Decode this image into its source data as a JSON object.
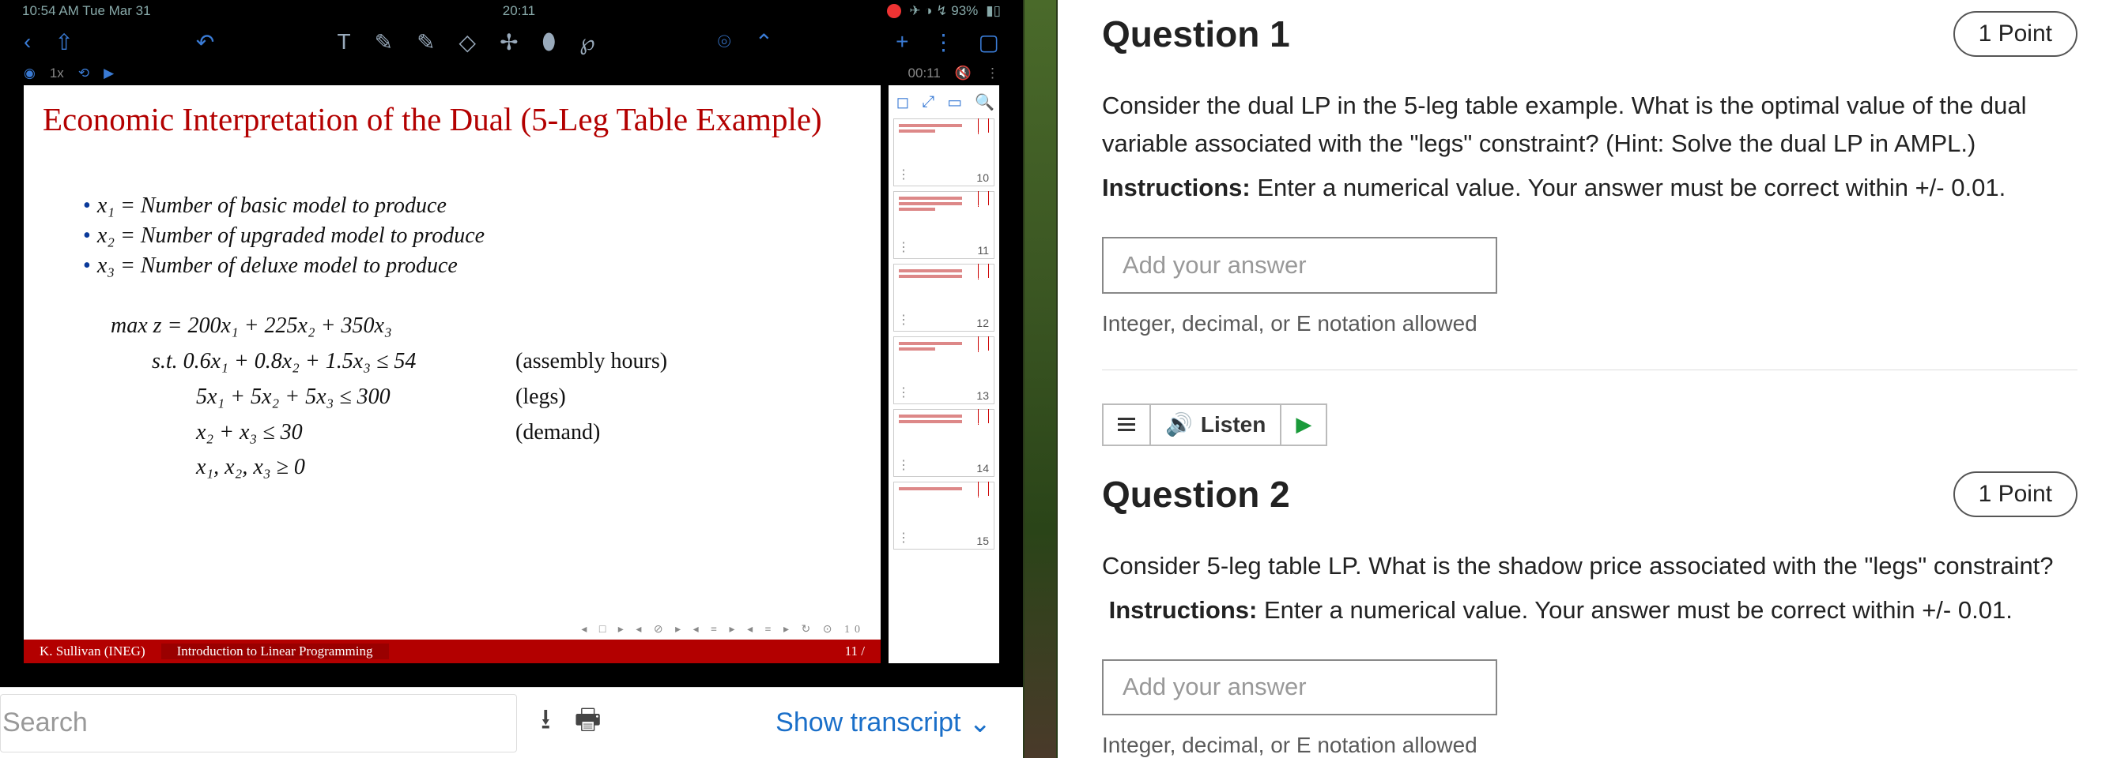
{
  "ipad": {
    "status_left": "10:54 AM   Tue Mar 31",
    "status_center": "20:11",
    "status_battery": "✈ ◑ ↯ 93%",
    "time_left_1x": "1x",
    "time_right_elapsed": "00:11",
    "slide": {
      "title": "Economic Interpretation of the Dual (5-Leg Table Example)",
      "bullets": [
        "x₁ = Number of basic model to produce",
        "x₂ = Number of upgraded model to produce",
        "x₃ = Number of deluxe model to produce"
      ],
      "obj": "max z = 200x₁ + 225x₂ + 350x₃",
      "c1_lhs": "s.t.  0.6x₁ + 0.8x₂ + 1.5x₃ ≤ 54",
      "c1_lab": "(assembly hours)",
      "c2_lhs": "5x₁ + 5x₂ + 5x₃ ≤ 300",
      "c2_lab": "(legs)",
      "c3_lhs": "x₂ + x₃ ≤ 30",
      "c3_lab": "(demand)",
      "c4_lhs": "x₁, x₂, x₃ ≥ 0",
      "footer_author": "K. Sullivan  (INEG)",
      "footer_title": "Introduction to Linear Programming",
      "footer_page": "11 /",
      "nav_icons": "◂ □ ▸  ◂ ⊘ ▸  ◂ ≡ ▸  ◂ ≡ ▸     ↻ ⊙ 10"
    },
    "thumbs": [
      "10",
      "11",
      "12",
      "13",
      "14",
      "15",
      "11"
    ]
  },
  "video_bar": {
    "search_placeholder": "Search",
    "show_transcript": "Show transcript"
  },
  "quiz": {
    "q1": {
      "title": "Question 1",
      "points": "1 Point",
      "text": "Consider the dual LP in the 5-leg table example.  What is the optimal value of the dual variable associated with the \"legs\" constraint?  (Hint: Solve the dual LP in AMPL.)",
      "instr_label": "Instructions:",
      "instr_text": " Enter a numerical value.  Your answer must be correct within +/- 0.01.",
      "placeholder": "Add your answer",
      "hint": "Integer, decimal, or E notation allowed"
    },
    "listen": "Listen",
    "q2": {
      "title": "Question 2",
      "points": "1 Point",
      "text": "Consider 5-leg table LP.  What is the shadow price associated with the \"legs\" constraint?",
      "instr_label": "Instructions:",
      "instr_text": " Enter a numerical value.  Your answer must be correct within +/- 0.01.",
      "placeholder": "Add your answer",
      "hint": "Integer, decimal, or E notation allowed"
    }
  }
}
